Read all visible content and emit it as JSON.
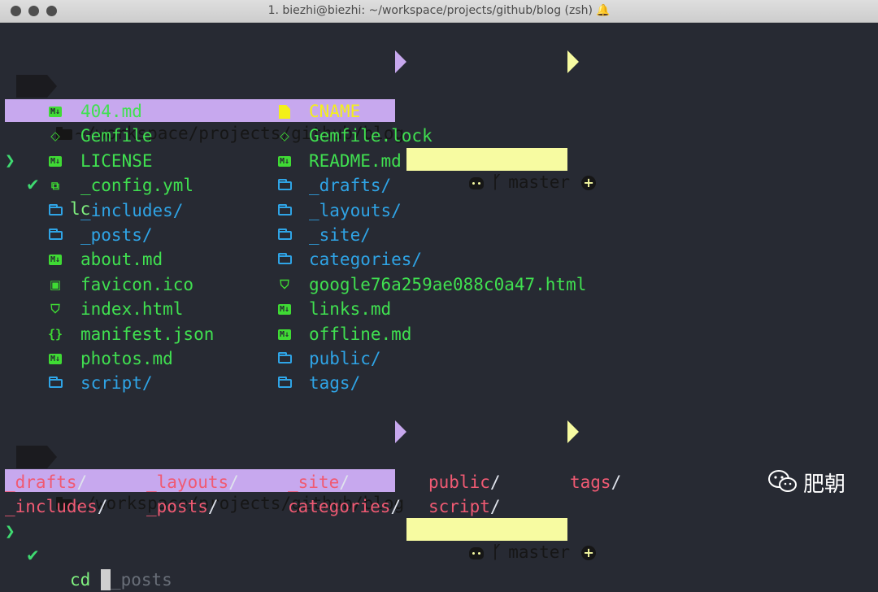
{
  "window": {
    "title": "1. biezhi@biezhi: ~/workspace/projects/github/blog (zsh)",
    "bell_icon": "bell-icon",
    "traffic_lights": [
      "close",
      "minimize",
      "zoom"
    ]
  },
  "prompt": {
    "path": "~/workspace/projects/github/blog",
    "branch": "master",
    "path_bg": "#c7a8ee",
    "git_bg": "#f7fba1"
  },
  "commands": {
    "first": "lc",
    "second": "cd ",
    "second_suggestion": "_posts"
  },
  "listing": {
    "left": [
      {
        "name": "404.md",
        "icon": "markdown-icon"
      },
      {
        "name": "Gemfile",
        "icon": "gem-icon"
      },
      {
        "name": "LICENSE",
        "icon": "markdown-icon"
      },
      {
        "name": "_config.yml",
        "icon": "config-file-icon"
      },
      {
        "name": "_includes/",
        "icon": "folder-icon"
      },
      {
        "name": "_posts/",
        "icon": "folder-icon"
      },
      {
        "name": "about.md",
        "icon": "markdown-icon"
      },
      {
        "name": "favicon.ico",
        "icon": "image-icon"
      },
      {
        "name": "index.html",
        "icon": "html5-icon"
      },
      {
        "name": "manifest.json",
        "icon": "json-icon"
      },
      {
        "name": "photos.md",
        "icon": "markdown-icon"
      },
      {
        "name": "script/",
        "icon": "folder-icon"
      }
    ],
    "right": [
      {
        "name": "CNAME",
        "icon": "file-icon"
      },
      {
        "name": "Gemfile.lock",
        "icon": "gem-icon"
      },
      {
        "name": "README.md",
        "icon": "markdown-icon"
      },
      {
        "name": "_drafts/",
        "icon": "folder-icon"
      },
      {
        "name": "_layouts/",
        "icon": "folder-icon"
      },
      {
        "name": "_site/",
        "icon": "folder-icon"
      },
      {
        "name": "categories/",
        "icon": "folder-icon"
      },
      {
        "name": "google76a259ae088c0a47.html",
        "icon": "html5-icon"
      },
      {
        "name": "links.md",
        "icon": "markdown-icon"
      },
      {
        "name": "offline.md",
        "icon": "markdown-icon"
      },
      {
        "name": "public/",
        "icon": "folder-icon"
      },
      {
        "name": "tags/",
        "icon": "folder-icon"
      }
    ]
  },
  "completions": {
    "row1": [
      "_drafts",
      "_layouts",
      "_site",
      "public",
      "tags"
    ],
    "row2": [
      "_includes",
      "_posts",
      "categories",
      "script"
    ],
    "separator": "/"
  },
  "watermark": {
    "text": "肥朝",
    "icon": "wechat-icon"
  }
}
